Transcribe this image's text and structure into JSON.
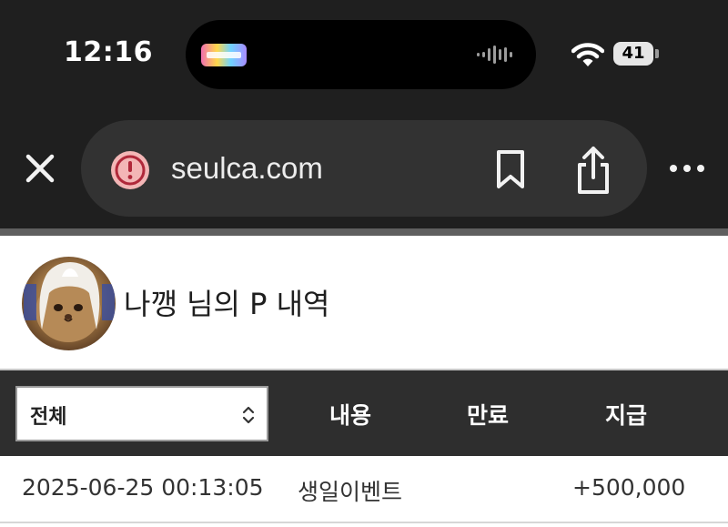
{
  "status_bar": {
    "time": "12:16",
    "battery": "41"
  },
  "browser": {
    "url": "seulca.com",
    "icons": [
      "close-icon",
      "security-warning-icon",
      "bookmark-icon",
      "share-icon",
      "more-icon"
    ]
  },
  "page": {
    "title": "나깽 님의 P 내역"
  },
  "table": {
    "filter_value": "전체",
    "headers": {
      "content": "내용",
      "expire": "만료",
      "grant": "지급"
    },
    "rows": [
      {
        "date": "2025-06-25 00:13:05",
        "content": "생일이벤트",
        "expire": "",
        "grant": "+500,000"
      }
    ]
  },
  "colors": {
    "chrome_bg": "#1f1f1f",
    "url_pill": "#323232",
    "warning_accent": "#f3b6b6",
    "table_header_bg": "#2e2e2e"
  }
}
